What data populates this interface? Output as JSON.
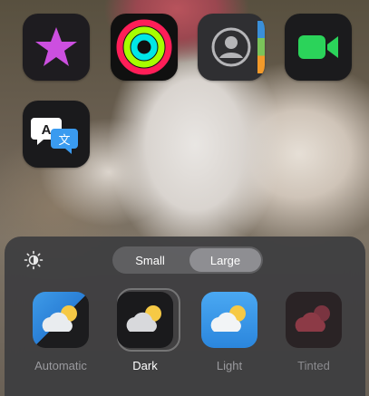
{
  "home_screen": {
    "apps": [
      {
        "icon": "star-icon",
        "app": "itunes-store"
      },
      {
        "icon": "activity-rings-icon",
        "app": "fitness"
      },
      {
        "icon": "person-icon",
        "app": "contacts"
      },
      {
        "icon": "video-camera-icon",
        "app": "facetime"
      },
      {
        "icon": "translate-icon",
        "app": "translate"
      }
    ]
  },
  "customize_sheet": {
    "size_options": [
      {
        "label": "Small",
        "selected": false
      },
      {
        "label": "Large",
        "selected": true
      }
    ],
    "appearance_options": [
      {
        "label": "Automatic",
        "selected": false
      },
      {
        "label": "Dark",
        "selected": true
      },
      {
        "label": "Light",
        "selected": false
      },
      {
        "label": "Tinted",
        "selected": false
      }
    ],
    "brightness_icon": "sun-brightness-icon"
  }
}
